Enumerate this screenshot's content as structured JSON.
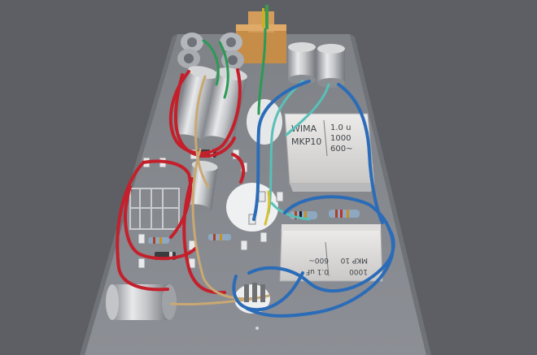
{
  "scene": {
    "colors": {
      "background": "#5d5f64",
      "chassis": "#86898f",
      "wire_red": "#c4202c",
      "wire_blue": "#2b6cb8",
      "wire_green": "#2a9a55",
      "wire_cyan": "#58c0b8",
      "wire_tan": "#c9a873",
      "transformer": "#c8924f"
    }
  },
  "capacitor_1": {
    "brand": "WIMA",
    "series": "MKP10",
    "value": "1.0 u",
    "voltage": "1000",
    "tolerance": "600~"
  },
  "capacitor_2": {
    "series": "MKP 10",
    "value": "0.1 uF",
    "voltage": "1000",
    "tolerance": "600~"
  }
}
